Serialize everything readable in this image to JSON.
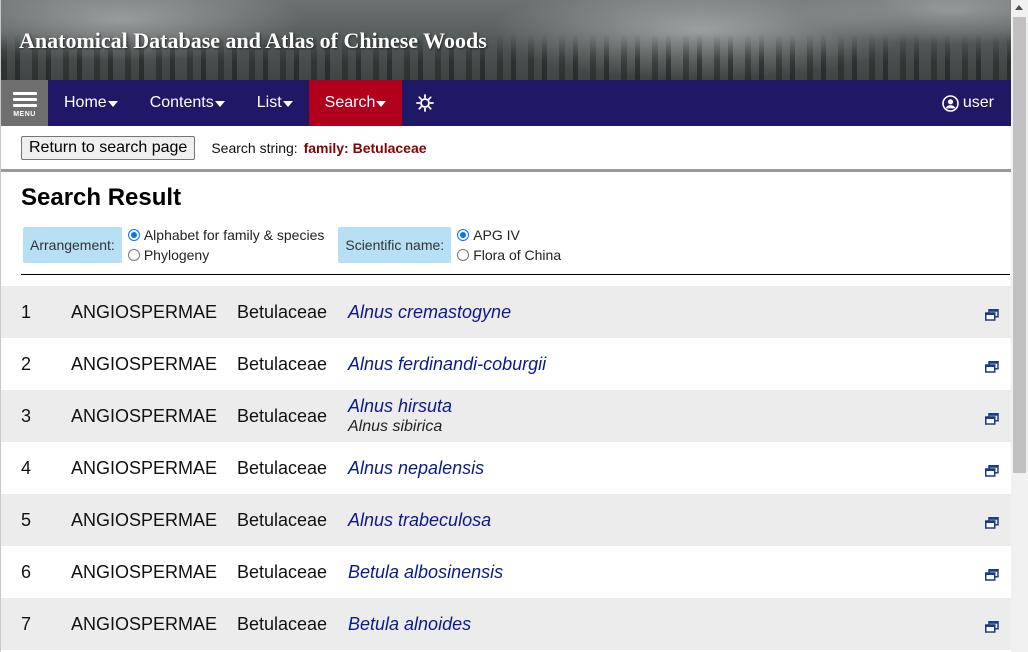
{
  "header": {
    "title": "Anatomical Database and Atlas of Chinese Woods"
  },
  "navbar": {
    "menu_label": "MENU",
    "items": [
      {
        "label": "Home"
      },
      {
        "label": "Contents"
      },
      {
        "label": "List"
      },
      {
        "label": "Search"
      }
    ],
    "active_color": "#b0001e",
    "background": "#1e1866",
    "settings_icon": "sun-gear-icon",
    "user_label": "user",
    "user_icon": "user-circle-icon"
  },
  "search_bar": {
    "return_button": "Return to search page",
    "search_string_label": "Search string:",
    "search_string_value": "family: Betulaceae"
  },
  "result": {
    "heading": "Search Result",
    "arrangement_label": "Arrangement:",
    "arrangement_options": [
      {
        "label": "Alphabet for family & species",
        "selected": true
      },
      {
        "label": "Phylogeny",
        "selected": false
      }
    ],
    "scientific_name_label": "Scientific name:",
    "scientific_name_options": [
      {
        "label": "APG IV",
        "selected": true
      },
      {
        "label": "Flora of China",
        "selected": false
      }
    ]
  },
  "rows": [
    {
      "num": "1",
      "class": "ANGIOSPERMAE",
      "family": "Betulaceae",
      "species": "Alnus cremastogyne",
      "synonym": ""
    },
    {
      "num": "2",
      "class": "ANGIOSPERMAE",
      "family": "Betulaceae",
      "species": "Alnus ferdinandi-coburgii",
      "synonym": ""
    },
    {
      "num": "3",
      "class": "ANGIOSPERMAE",
      "family": "Betulaceae",
      "species": "Alnus hirsuta",
      "synonym": "Alnus sibirica"
    },
    {
      "num": "4",
      "class": "ANGIOSPERMAE",
      "family": "Betulaceae",
      "species": "Alnus nepalensis",
      "synonym": ""
    },
    {
      "num": "5",
      "class": "ANGIOSPERMAE",
      "family": "Betulaceae",
      "species": "Alnus trabeculosa",
      "synonym": ""
    },
    {
      "num": "6",
      "class": "ANGIOSPERMAE",
      "family": "Betulaceae",
      "species": "Betula albosinensis",
      "synonym": ""
    },
    {
      "num": "7",
      "class": "ANGIOSPERMAE",
      "family": "Betulaceae",
      "species": "Betula alnoides",
      "synonym": ""
    }
  ],
  "row_icon": "open-in-window-icon",
  "colors": {
    "species_link": "#0b1a8c",
    "search_value": "#8a0000",
    "option_label_bg": "#b7e0f5"
  }
}
